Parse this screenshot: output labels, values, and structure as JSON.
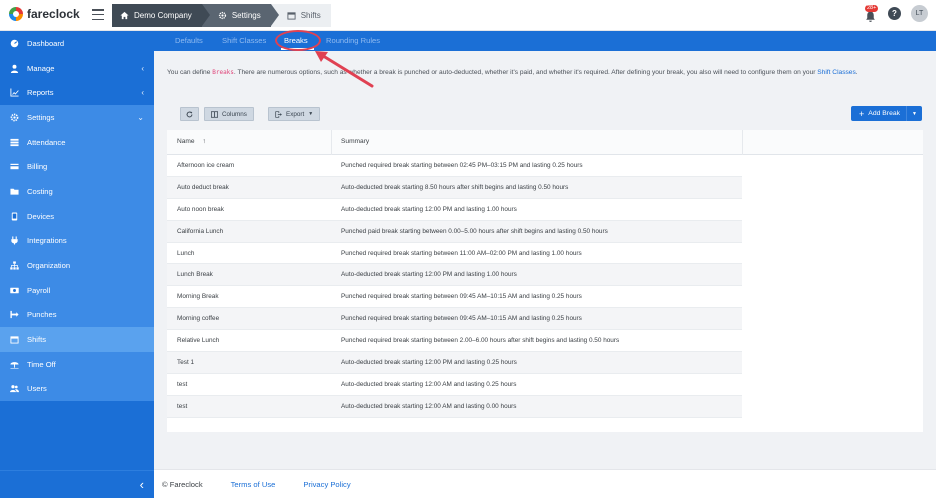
{
  "app": {
    "name": "fareclock"
  },
  "breadcrumbs": [
    {
      "label": "Demo Company",
      "icon": "home-icon"
    },
    {
      "label": "Settings",
      "icon": "gear-icon"
    },
    {
      "label": "Shifts",
      "icon": "calendar-icon"
    }
  ],
  "header": {
    "notification_count": "28+",
    "help_label": "?",
    "user_initials": "LT"
  },
  "sidebar": {
    "items": [
      {
        "label": "Dashboard",
        "icon": "dashboard-icon"
      },
      {
        "label": "Manage",
        "icon": "user-icon",
        "chevron": "‹"
      },
      {
        "label": "Reports",
        "icon": "chart-icon",
        "chevron": "‹"
      },
      {
        "label": "Settings",
        "icon": "gear-icon",
        "chevron": "⌄"
      },
      {
        "label": "Attendance",
        "icon": "list-icon"
      },
      {
        "label": "Billing",
        "icon": "billing-icon"
      },
      {
        "label": "Costing",
        "icon": "folder-icon"
      },
      {
        "label": "Devices",
        "icon": "device-icon"
      },
      {
        "label": "Integrations",
        "icon": "plug-icon"
      },
      {
        "label": "Organization",
        "icon": "org-icon"
      },
      {
        "label": "Payroll",
        "icon": "money-icon"
      },
      {
        "label": "Punches",
        "icon": "punch-icon"
      },
      {
        "label": "Shifts",
        "icon": "shifts-icon"
      },
      {
        "label": "Time Off",
        "icon": "umbrella-icon"
      },
      {
        "label": "Users",
        "icon": "users-icon"
      }
    ],
    "collapse_label": "‹"
  },
  "tabs": [
    {
      "label": "Defaults"
    },
    {
      "label": "Shift Classes"
    },
    {
      "label": "Breaks"
    },
    {
      "label": "Rounding Rules"
    }
  ],
  "intro": {
    "prefix": "You can define ",
    "highlight": "Breaks",
    "middle": ". There are numerous options, such as whether a break is punched or auto-deducted, whether it's paid, and whether it's required. After defining your break, you also will need to configure them on your ",
    "link": "Shift Classes",
    "suffix": "."
  },
  "toolbar": {
    "refresh_label": "",
    "columns_label": "Columns",
    "export_label": "Export",
    "add_label": "Add Break",
    "add_plus": "+"
  },
  "table": {
    "headers": {
      "name": "Name",
      "sort_arrow": "↑",
      "summary": "Summary"
    },
    "rows": [
      {
        "name": "Afternoon ice cream",
        "summary": "Punched required break starting between 02:45 PM–03:15 PM and lasting 0.25 hours"
      },
      {
        "name": "Auto deduct break",
        "summary": "Auto-deducted break starting 8.50 hours after shift begins and lasting 0.50 hours"
      },
      {
        "name": "Auto noon break",
        "summary": "Auto-deducted break starting 12:00 PM and lasting 1.00 hours"
      },
      {
        "name": "California Lunch",
        "summary": "Punched paid break starting between 0.00–5.00 hours after shift begins and lasting 0.50 hours"
      },
      {
        "name": "Lunch",
        "summary": "Punched required break starting between 11:00 AM–02:00 PM and lasting 1.00 hours"
      },
      {
        "name": "Lunch Break",
        "summary": "Auto-deducted break starting 12:00 PM and lasting 1.00 hours"
      },
      {
        "name": "Morning Break",
        "summary": "Punched required break starting between 09:45 AM–10:15 AM and lasting 0.25 hours"
      },
      {
        "name": "Morning coffee",
        "summary": "Punched required break starting between 09:45 AM–10:15 AM and lasting 0.25 hours"
      },
      {
        "name": "Relative Lunch",
        "summary": "Punched required break starting between 2.00–6.00 hours after shift begins and lasting 0.50 hours"
      },
      {
        "name": "Test 1",
        "summary": "Auto-deducted break starting 12:00 PM and lasting 0.25 hours"
      },
      {
        "name": "test",
        "summary": "Auto-deducted break starting 12:00 AM and lasting 0.25 hours"
      },
      {
        "name": "test",
        "summary": "Auto-deducted break starting 12:00 AM and lasting 0.00 hours"
      }
    ]
  },
  "footer": {
    "copyright": "© Fareclock",
    "terms": "Terms of Use",
    "privacy": "Privacy Policy"
  },
  "colors": {
    "primary": "#1b6fd6",
    "annotation": "#e04152"
  }
}
